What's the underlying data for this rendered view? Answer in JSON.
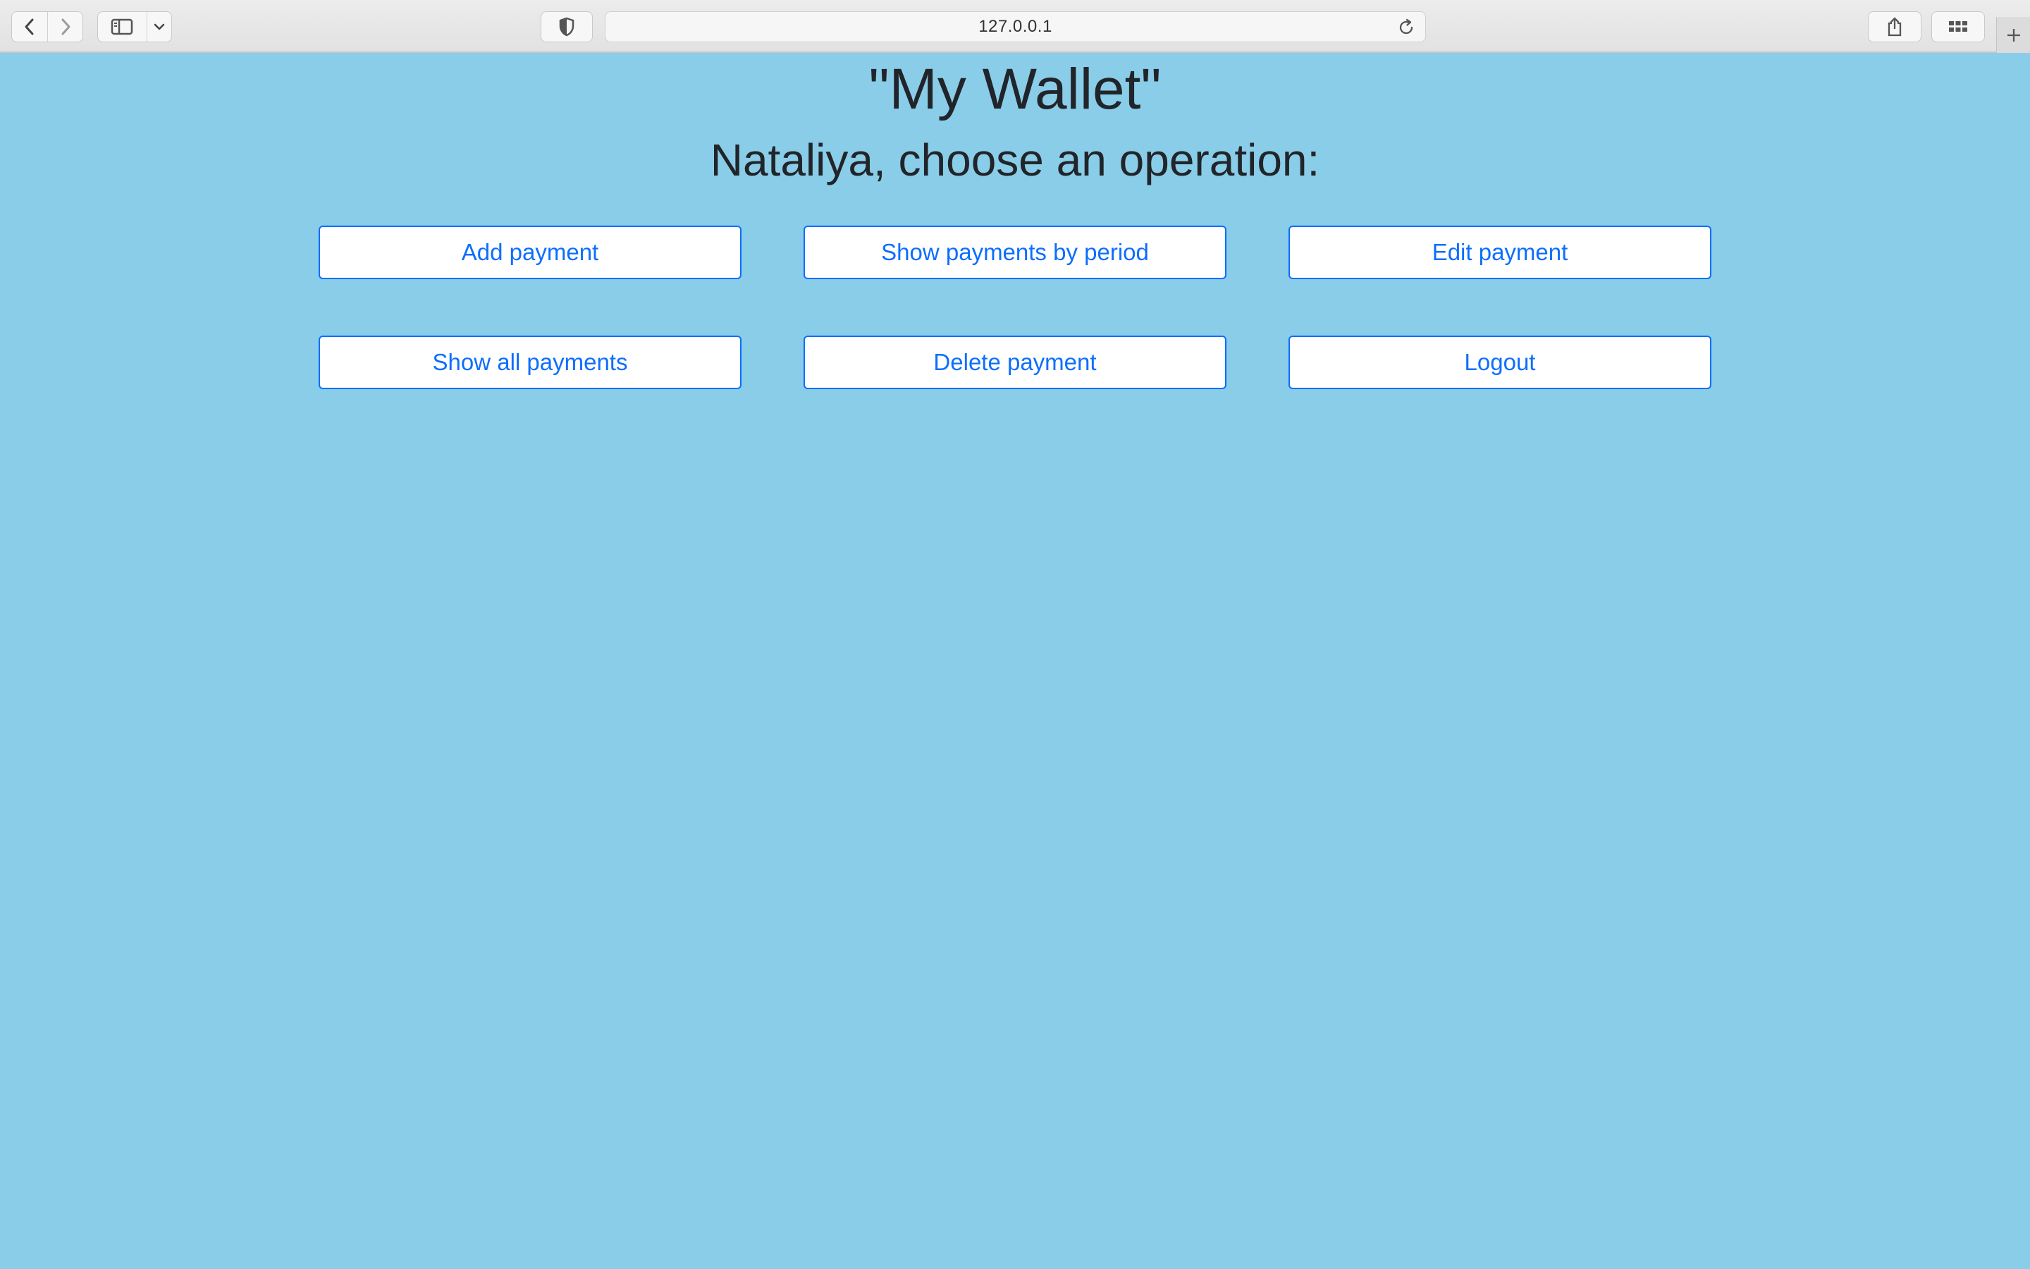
{
  "browser": {
    "url": "127.0.0.1",
    "icons": {
      "back": "chevron-left-icon",
      "forward": "chevron-right-icon",
      "sidebar": "sidebar-icon",
      "dropdown": "chevron-down-icon",
      "privacy": "shield-icon",
      "reload": "reload-icon",
      "share": "share-icon",
      "tabs": "tab-overview-icon",
      "new_tab": "plus-icon"
    }
  },
  "page": {
    "title": "\"My Wallet\"",
    "subtitle": "Nataliya, choose an operation:",
    "background_color": "#8acde9",
    "accent_color": "#0d6efd",
    "buttons": [
      {
        "label": "Add payment"
      },
      {
        "label": "Show payments by period"
      },
      {
        "label": "Edit payment"
      },
      {
        "label": "Show all payments"
      },
      {
        "label": "Delete payment"
      },
      {
        "label": "Logout"
      }
    ]
  }
}
